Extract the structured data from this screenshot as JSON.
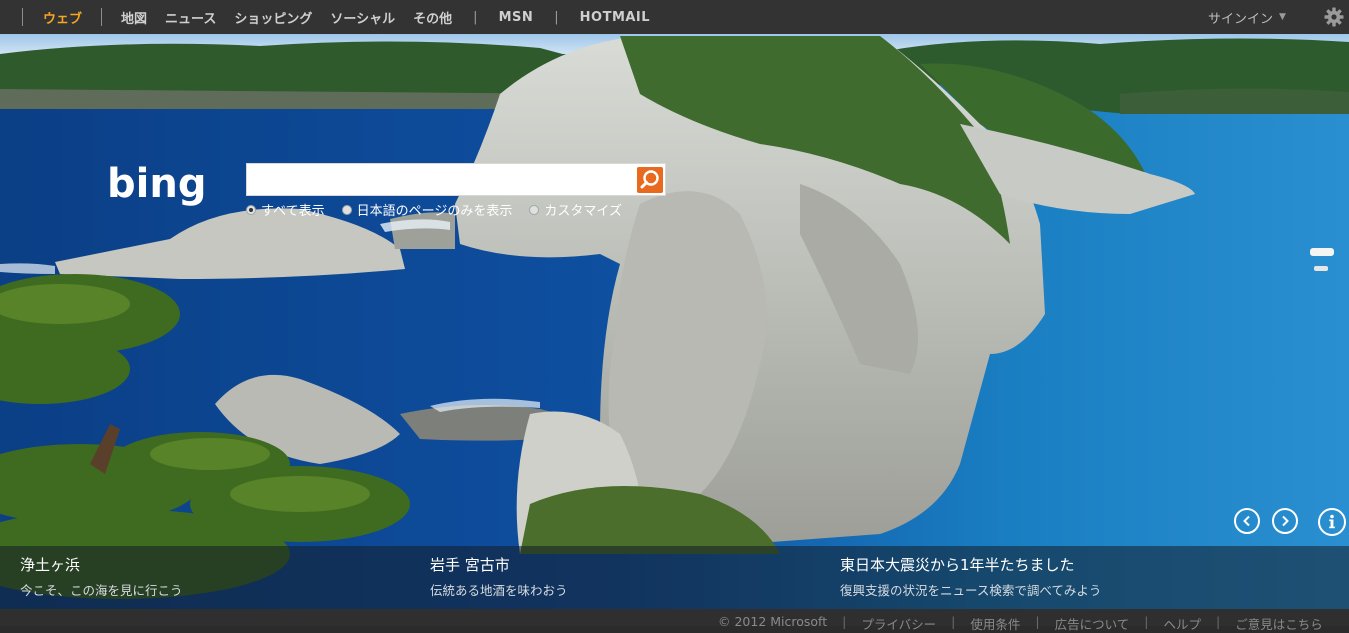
{
  "nav": {
    "items": [
      {
        "label": "ウェブ",
        "active": true
      },
      {
        "label": "地図"
      },
      {
        "label": "ニュース"
      },
      {
        "label": "ショッピング"
      },
      {
        "label": "ソーシャル"
      },
      {
        "label": "その他"
      }
    ],
    "msn": "MSN",
    "hotmail": "HOTMAIL",
    "divider": "|"
  },
  "account": {
    "signin_label": "サインイン",
    "caret_icon": "chevron-down-icon",
    "settings_icon": "gear-icon"
  },
  "search": {
    "value": "",
    "placeholder": "",
    "button_icon": "search-icon",
    "options": [
      {
        "label": "すべて表示",
        "selected": true
      },
      {
        "label": "日本語のページのみを表示",
        "selected": false
      },
      {
        "label": "カスタマイズ",
        "selected": false
      }
    ]
  },
  "brand": {
    "logo_text": "bing",
    "accent": "#e86a1f"
  },
  "hotspots": [
    {
      "title": "浄土ヶ浜",
      "subtitle": "今こそ、この海を見に行こう"
    },
    {
      "title": "岩手 宮古市",
      "subtitle": "伝統ある地酒を味わおう"
    },
    {
      "title": "東日本大震災から1年半たちました",
      "subtitle": "復興支援の状況をニュース検索で調べてみよう"
    }
  ],
  "controls": {
    "prev_icon": "chevron-left-icon",
    "next_icon": "chevron-right-icon",
    "info_icon": "info-icon"
  },
  "footer": {
    "copyright": "© 2012 Microsoft",
    "links": [
      "プライバシー",
      "使用条件",
      "広告について",
      "ヘルプ",
      "ご意見はこちら"
    ],
    "divider": "|"
  },
  "colors": {
    "topbar": "#333333",
    "active_nav": "#f5a623",
    "footer": "#2f2f2f"
  }
}
